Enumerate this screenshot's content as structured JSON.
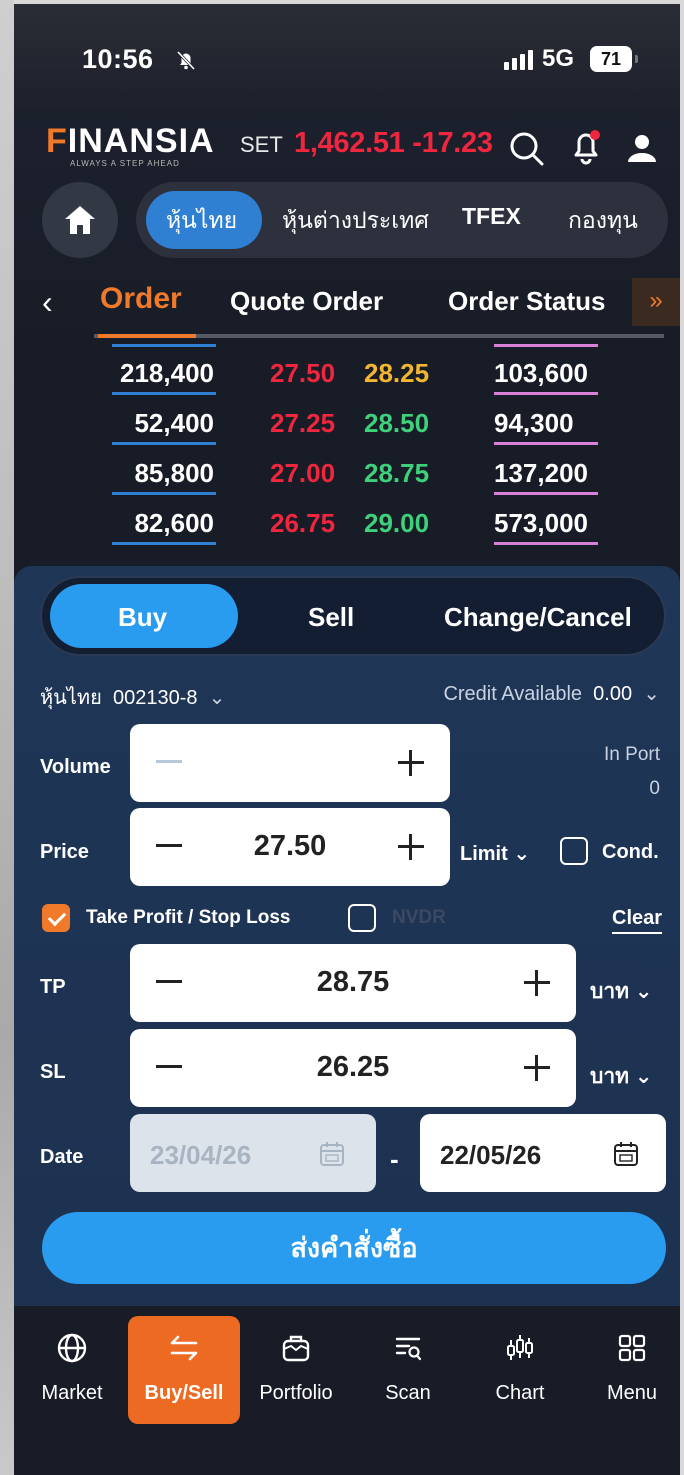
{
  "status_bar": {
    "time": "10:56",
    "network": "5G",
    "battery": "71"
  },
  "header": {
    "logo": "FINANSIA",
    "logo_first_letter": "F",
    "logo_rest": "INANSIA",
    "tagline": "ALWAYS A STEP AHEAD",
    "index_name": "SET",
    "index_value": "1,462.51",
    "index_change": "-17.23"
  },
  "market_tabs": [
    "หุ้นไทย",
    "หุ้นต่างประเทศ",
    "TFEX",
    "กองทุน"
  ],
  "order_tabs": {
    "active": "Order",
    "items": [
      "Order",
      "Quote Order",
      "Order Status"
    ]
  },
  "depth": [
    {
      "bid_volume": "218,400",
      "bid_price": "27.50",
      "ask_price": "28.25",
      "ask_volume": "103,600"
    },
    {
      "bid_volume": "52,400",
      "bid_price": "27.25",
      "ask_price": "28.50",
      "ask_volume": "94,300"
    },
    {
      "bid_volume": "85,800",
      "bid_price": "27.00",
      "ask_price": "28.75",
      "ask_volume": "137,200"
    },
    {
      "bid_volume": "82,600",
      "bid_price": "26.75",
      "ask_price": "29.00",
      "ask_volume": "573,000"
    }
  ],
  "colors": {
    "accent": "#f07a2a",
    "buy_blue": "#2a9cf0",
    "bid_red": "#f0263f",
    "ask_yellow": "#f2b630",
    "ask_green": "#3ed07a"
  },
  "order_form": {
    "sides": [
      "Buy",
      "Sell",
      "Change/Cancel"
    ],
    "active_side": "Buy",
    "account_label": "หุ้นไทย",
    "account_number": "002130-8",
    "credit_label": "Credit Available",
    "credit_value": "0.00",
    "volume_label": "Volume",
    "volume_value": "",
    "in_port_label": "In Port",
    "in_port_value": "0",
    "price_label": "Price",
    "price_value": "27.50",
    "price_type": "Limit",
    "cond_label": "Cond.",
    "tpsl_label": "Take Profit / Stop Loss",
    "tpsl_checked": true,
    "nvdr_label": "NVDR",
    "clear_label": "Clear",
    "tp_label": "TP",
    "tp_value": "28.75",
    "tp_unit": "บาท",
    "sl_label": "SL",
    "sl_value": "26.25",
    "sl_unit": "บาท",
    "date_label": "Date",
    "date_from": "23/04/26",
    "date_separator": "-",
    "date_to": "22/05/26",
    "submit_label": "ส่งคำสั่งซื้อ"
  },
  "bottom_nav": [
    {
      "label": "Market",
      "icon": "globe-icon"
    },
    {
      "label": "Buy/Sell",
      "icon": "swap-icon",
      "active": true
    },
    {
      "label": "Portfolio",
      "icon": "briefcase-icon"
    },
    {
      "label": "Scan",
      "icon": "scan-icon"
    },
    {
      "label": "Chart",
      "icon": "candlestick-icon"
    },
    {
      "label": "Menu",
      "icon": "grid-icon"
    }
  ]
}
